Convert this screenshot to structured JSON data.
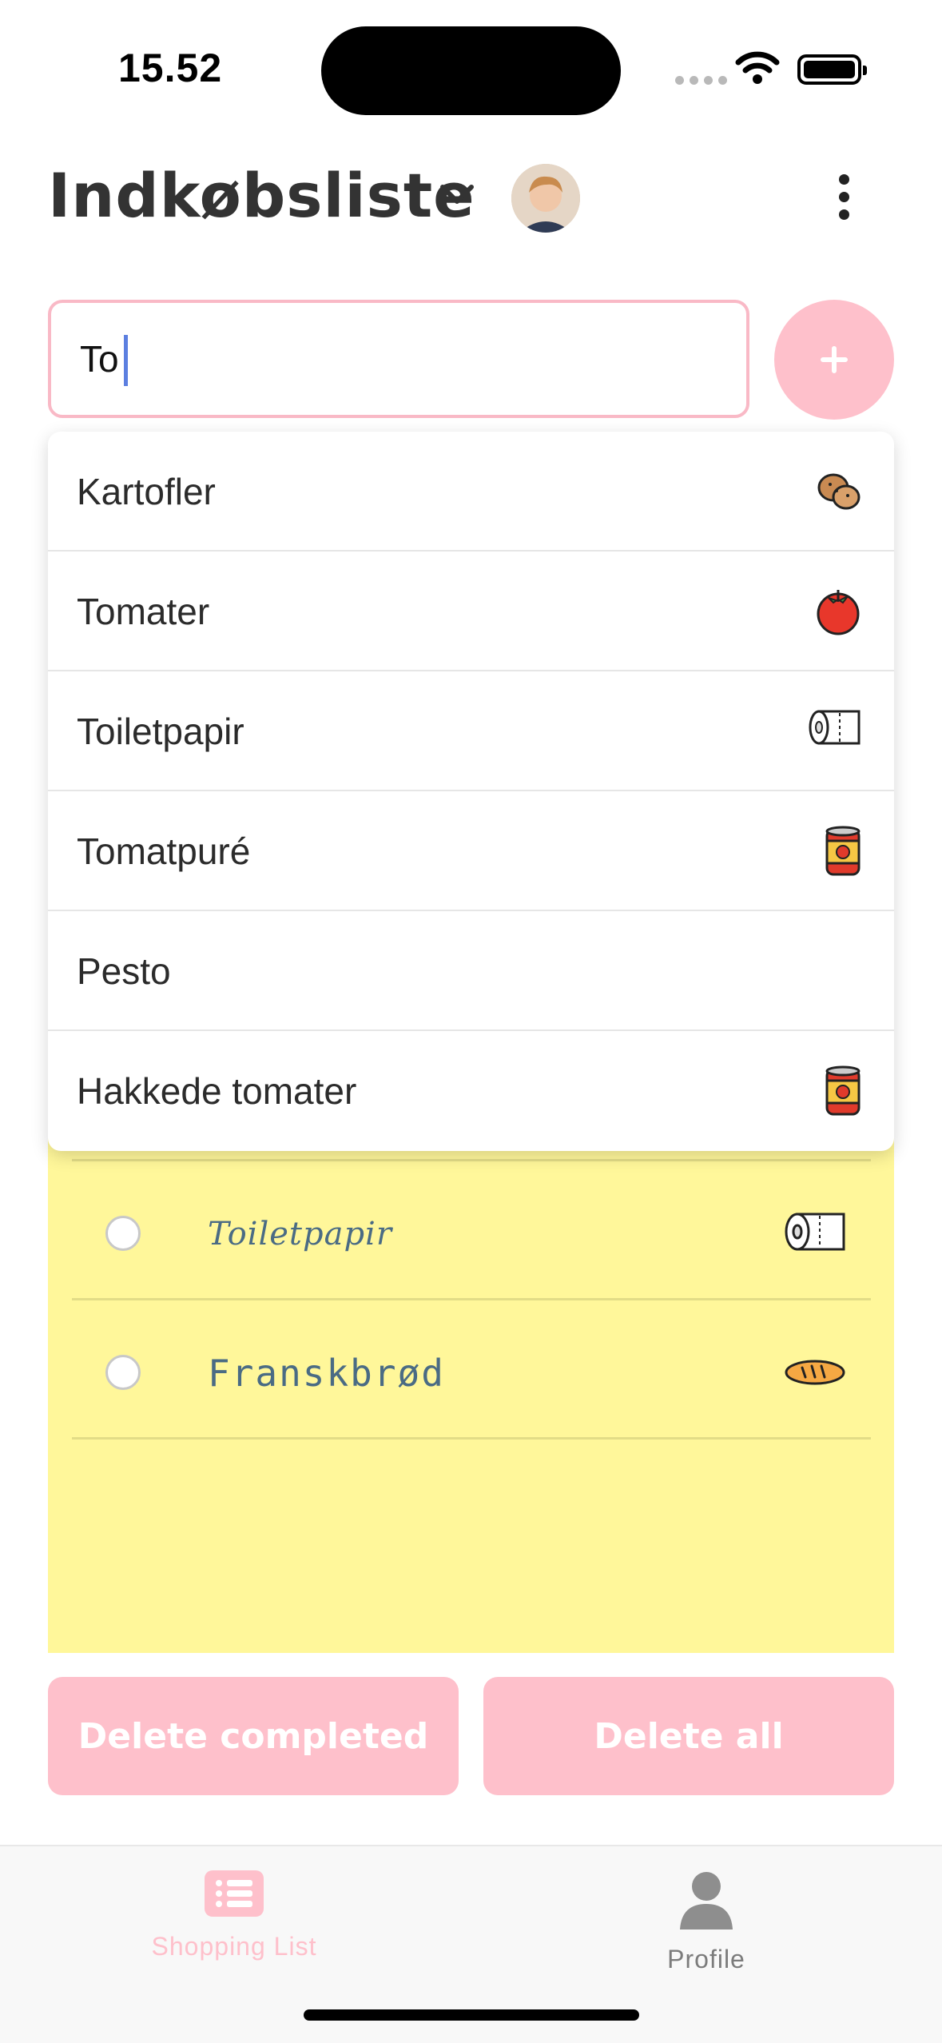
{
  "status_bar": {
    "time": "15.52",
    "icons": [
      "signal-icon",
      "wifi-icon",
      "battery-icon"
    ]
  },
  "header": {
    "title": "Indkøbsliste",
    "chevron_icon": "chevron-down-icon",
    "menu_icon": "more-vertical-icon"
  },
  "search": {
    "value": "To",
    "add_icon": "plus-icon"
  },
  "suggestions": [
    {
      "label": "Kartofler",
      "icon": "potato-icon"
    },
    {
      "label": "Tomater",
      "icon": "tomato-icon"
    },
    {
      "label": "Toiletpapir",
      "icon": "toilet-paper-icon"
    },
    {
      "label": "Tomatpuré",
      "icon": "can-icon"
    },
    {
      "label": "Pesto",
      "icon": ""
    },
    {
      "label": "Hakkede tomater",
      "icon": "can-icon"
    }
  ],
  "list_items": [
    {
      "label": "Toiletpapir",
      "icon": "toilet-paper-icon",
      "checked": false
    },
    {
      "label": "Franskbrød",
      "icon": "bread-icon",
      "checked": false
    }
  ],
  "actions": {
    "delete_completed": "Delete completed",
    "delete_all": "Delete all"
  },
  "tabs": [
    {
      "label": "Shopping List",
      "icon": "list-icon",
      "active": true
    },
    {
      "label": "Profile",
      "icon": "person-icon",
      "active": false
    }
  ],
  "colors": {
    "accent_pink": "#fec0cb",
    "note_yellow": "#fff79a",
    "caret_blue": "#5c7fe0",
    "item_text": "#4a6b84"
  }
}
